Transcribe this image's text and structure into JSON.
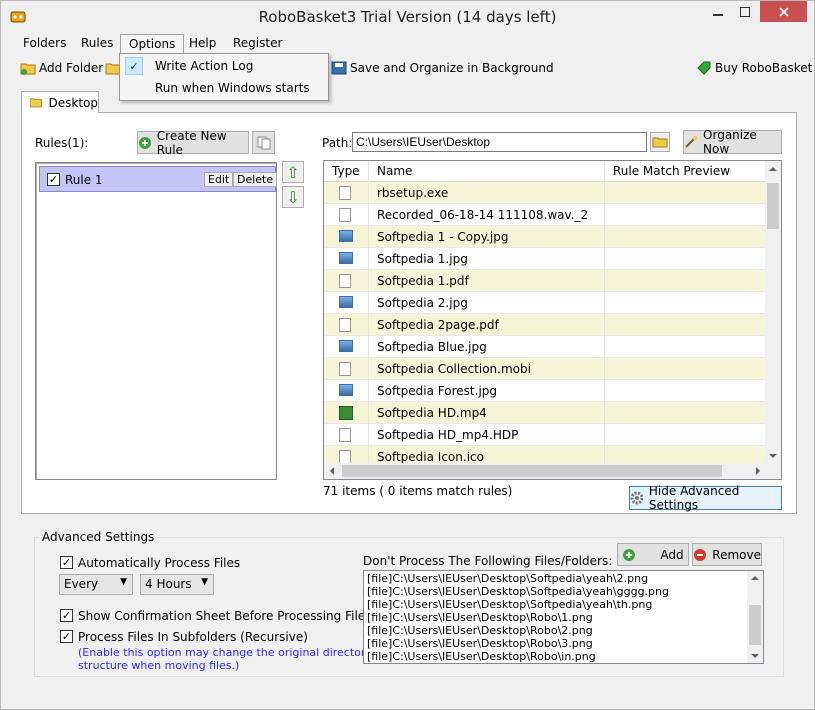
{
  "window": {
    "title": "RoboBasket3 Trial Version (14 days left)"
  },
  "menu": {
    "folders": "Folders",
    "rules": "Rules",
    "options": "Options",
    "help": "Help",
    "register": "Register"
  },
  "options_menu": {
    "write_log": "Write Action Log",
    "run_startup": "Run when Windows starts"
  },
  "toolbar": {
    "add_folder": "Add Folder",
    "background": "Save and Organize in Background",
    "buy": "Buy RoboBasket"
  },
  "tab": {
    "desktop": "Desktop"
  },
  "rules": {
    "label": "Rules(1):",
    "create": "Create New Rule",
    "items": [
      {
        "name": "Rule 1",
        "edit": "Edit",
        "delete": "Delete"
      }
    ]
  },
  "path": {
    "label": "Path:",
    "value": "C:\\Users\\IEUser\\Desktop",
    "organize": "Organize Now"
  },
  "grid": {
    "headers": [
      "Type",
      "Name",
      "Rule Match Preview"
    ],
    "rows": [
      {
        "type": "file",
        "name": "rbsetup.exe"
      },
      {
        "type": "file",
        "name": "Recorded_06-18-14 111108.wav._2"
      },
      {
        "type": "image",
        "name": "Softpedia 1 - Copy.jpg"
      },
      {
        "type": "image",
        "name": "Softpedia 1.jpg"
      },
      {
        "type": "file",
        "name": "Softpedia 1.pdf"
      },
      {
        "type": "image",
        "name": "Softpedia 2.jpg"
      },
      {
        "type": "file",
        "name": "Softpedia 2page.pdf"
      },
      {
        "type": "image",
        "name": "Softpedia Blue.jpg"
      },
      {
        "type": "file",
        "name": "Softpedia Collection.mobi"
      },
      {
        "type": "image",
        "name": "Softpedia Forest.jpg"
      },
      {
        "type": "video",
        "name": "Softpedia HD.mp4"
      },
      {
        "type": "file",
        "name": "Softpedia HD_mp4.HDP"
      },
      {
        "type": "file",
        "name": "Softpedia Icon.ico"
      }
    ],
    "count": "71 items ( 0 items match rules)"
  },
  "hide_advanced": "Hide Advanced Settings",
  "advanced": {
    "legend": "Advanced Settings",
    "auto_process": "Automatically Process Files",
    "every": "Every",
    "hours": "4 Hours",
    "show_confirm": "Show Confirmation Sheet Before Processing Files",
    "subfolders": "Process Files In Subfolders (Recursive)",
    "note_line1": "(Enable this option may change the original directory",
    "note_line2": "structure when moving files.)",
    "exclude_label": "Don't Process The Following Files/Folders:",
    "add": "Add",
    "remove": "Remove",
    "exclusions": [
      "[file]C:\\Users\\IEUser\\Desktop\\Softpedia\\yeah\\2.png",
      "[file]C:\\Users\\IEUser\\Desktop\\Softpedia\\yeah\\gggg.png",
      "[file]C:\\Users\\IEUser\\Desktop\\Softpedia\\yeah\\th.png",
      "[file]C:\\Users\\IEUser\\Desktop\\Robo\\1.png",
      "[file]C:\\Users\\IEUser\\Desktop\\Robo\\2.png",
      "[file]C:\\Users\\IEUser\\Desktop\\Robo\\3.png",
      "[file]C:\\Users\\IEUser\\Desktop\\Robo\\in.png"
    ]
  }
}
